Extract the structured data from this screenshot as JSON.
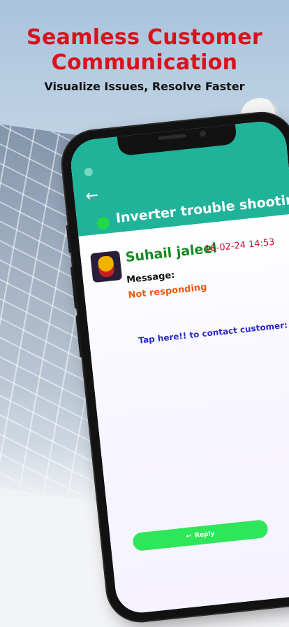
{
  "headline": {
    "title_line1": "Seamless Customer",
    "title_line2": "Communication",
    "subtitle": "Visualize Issues, Resolve Faster"
  },
  "app": {
    "title": "Inverter trouble shooting",
    "back_icon": "arrow-left-icon",
    "status": "online"
  },
  "message": {
    "sender": "Suhail jaleel",
    "timestamp": "16-02-24 14:53",
    "label": "Message:",
    "text": "Not responding",
    "contact_prompt": "Tap here!! to contact customer:"
  },
  "reply": {
    "label": "Reply",
    "icon": "reply-icon"
  },
  "colors": {
    "headline": "#d8131b",
    "appbar": "#1fb39a",
    "online": "#22d847",
    "sender": "#138a20",
    "timestamp": "#c8102e",
    "message": "#ec5a0c",
    "link": "#2a28c8",
    "reply_button": "#2ee65a"
  }
}
